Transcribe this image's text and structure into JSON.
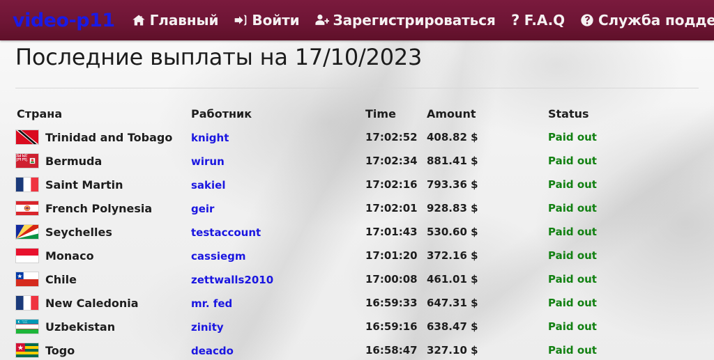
{
  "site": {
    "brand": "video-p11",
    "nav": [
      {
        "label": "Главный",
        "icon": "home-icon"
      },
      {
        "label": "Войти",
        "icon": "sign-in-icon"
      },
      {
        "label": "Зарегистрироваться",
        "icon": "user-plus-icon"
      },
      {
        "label": "F.A.Q",
        "icon": "question-mark-icon"
      },
      {
        "label": "Служба поддержки",
        "icon": "question-circle-icon"
      }
    ]
  },
  "page": {
    "heading": "Последние выплаты на 17/10/2023",
    "date": "17/10/2023"
  },
  "colors": {
    "navbar": "#6e1535",
    "brand": "#1a1ae6",
    "link": "#1a16e0",
    "status_paid": "#128012",
    "text": "#1d1d1d"
  },
  "table": {
    "columns": [
      "Страна",
      "Работник",
      "Time",
      "Amount",
      "Status"
    ],
    "rows": [
      {
        "flag": "tt",
        "country": "Trinidad and Tobago",
        "worker": "knight",
        "time": "17:02:52",
        "amount": "408.82 $",
        "status": "Paid out"
      },
      {
        "flag": "bm",
        "country": "Bermuda",
        "worker": "wirun",
        "time": "17:02:34",
        "amount": "881.41 $",
        "status": "Paid out"
      },
      {
        "flag": "mf",
        "country": "Saint Martin",
        "worker": "sakiel",
        "time": "17:02:16",
        "amount": "793.36 $",
        "status": "Paid out"
      },
      {
        "flag": "pf",
        "country": "French Polynesia",
        "worker": "geir",
        "time": "17:02:01",
        "amount": "928.83 $",
        "status": "Paid out"
      },
      {
        "flag": "sc",
        "country": "Seychelles",
        "worker": "testaccount",
        "time": "17:01:43",
        "amount": "530.60 $",
        "status": "Paid out"
      },
      {
        "flag": "mc",
        "country": "Monaco",
        "worker": "cassiegm",
        "time": "17:01:20",
        "amount": "372.16 $",
        "status": "Paid out"
      },
      {
        "flag": "cl",
        "country": "Chile",
        "worker": "zettwalls2010",
        "time": "17:00:08",
        "amount": "461.01 $",
        "status": "Paid out"
      },
      {
        "flag": "nc",
        "country": "New Caledonia",
        "worker": "mr. fed",
        "time": "16:59:33",
        "amount": "647.31 $",
        "status": "Paid out"
      },
      {
        "flag": "uz",
        "country": "Uzbekistan",
        "worker": "zinity",
        "time": "16:59:16",
        "amount": "638.47 $",
        "status": "Paid out"
      },
      {
        "flag": "tg",
        "country": "Togo",
        "worker": "deacdo",
        "time": "16:58:47",
        "amount": "327.10 $",
        "status": "Paid out"
      }
    ]
  }
}
